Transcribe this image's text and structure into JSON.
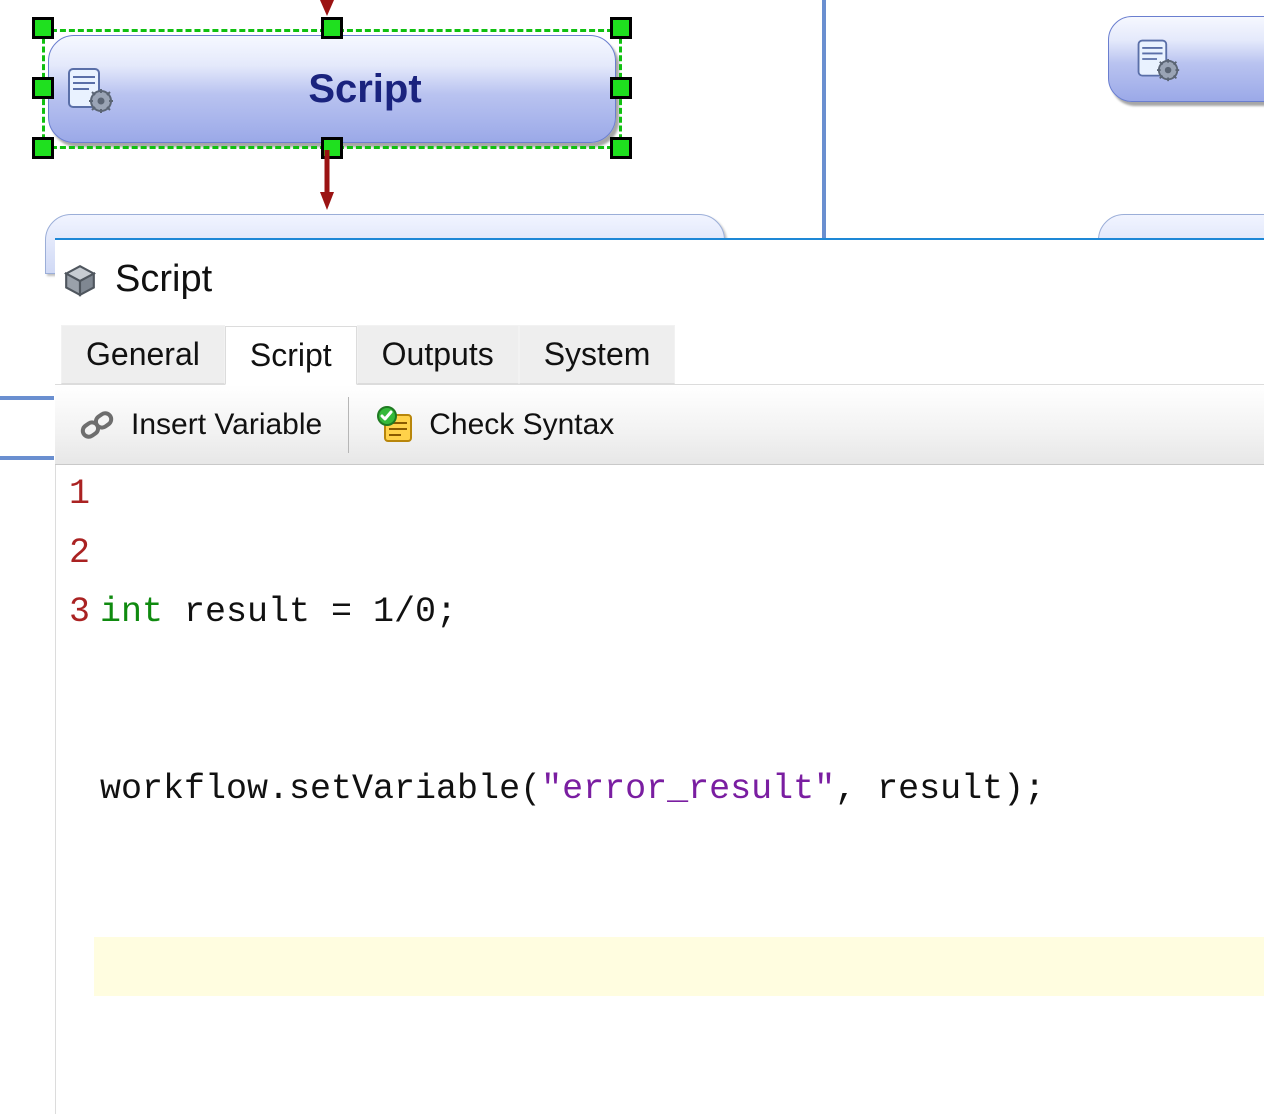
{
  "diagram": {
    "selected_node_label": "Script"
  },
  "panel": {
    "title": "Script",
    "tabs": {
      "general": "General",
      "script": "Script",
      "outputs": "Outputs",
      "system": "System"
    },
    "active_tab": "script"
  },
  "toolbar": {
    "insert_variable": "Insert Variable",
    "check_syntax": "Check Syntax"
  },
  "editor": {
    "line_numbers": [
      "1",
      "2",
      "3"
    ],
    "lines": {
      "l1_kw": "int",
      "l1_rest": " result = 1/0;",
      "l2_pre": "workflow.setVariable(",
      "l2_str": "\"error_result\"",
      "l2_post": ", result);",
      "l3": ""
    }
  }
}
